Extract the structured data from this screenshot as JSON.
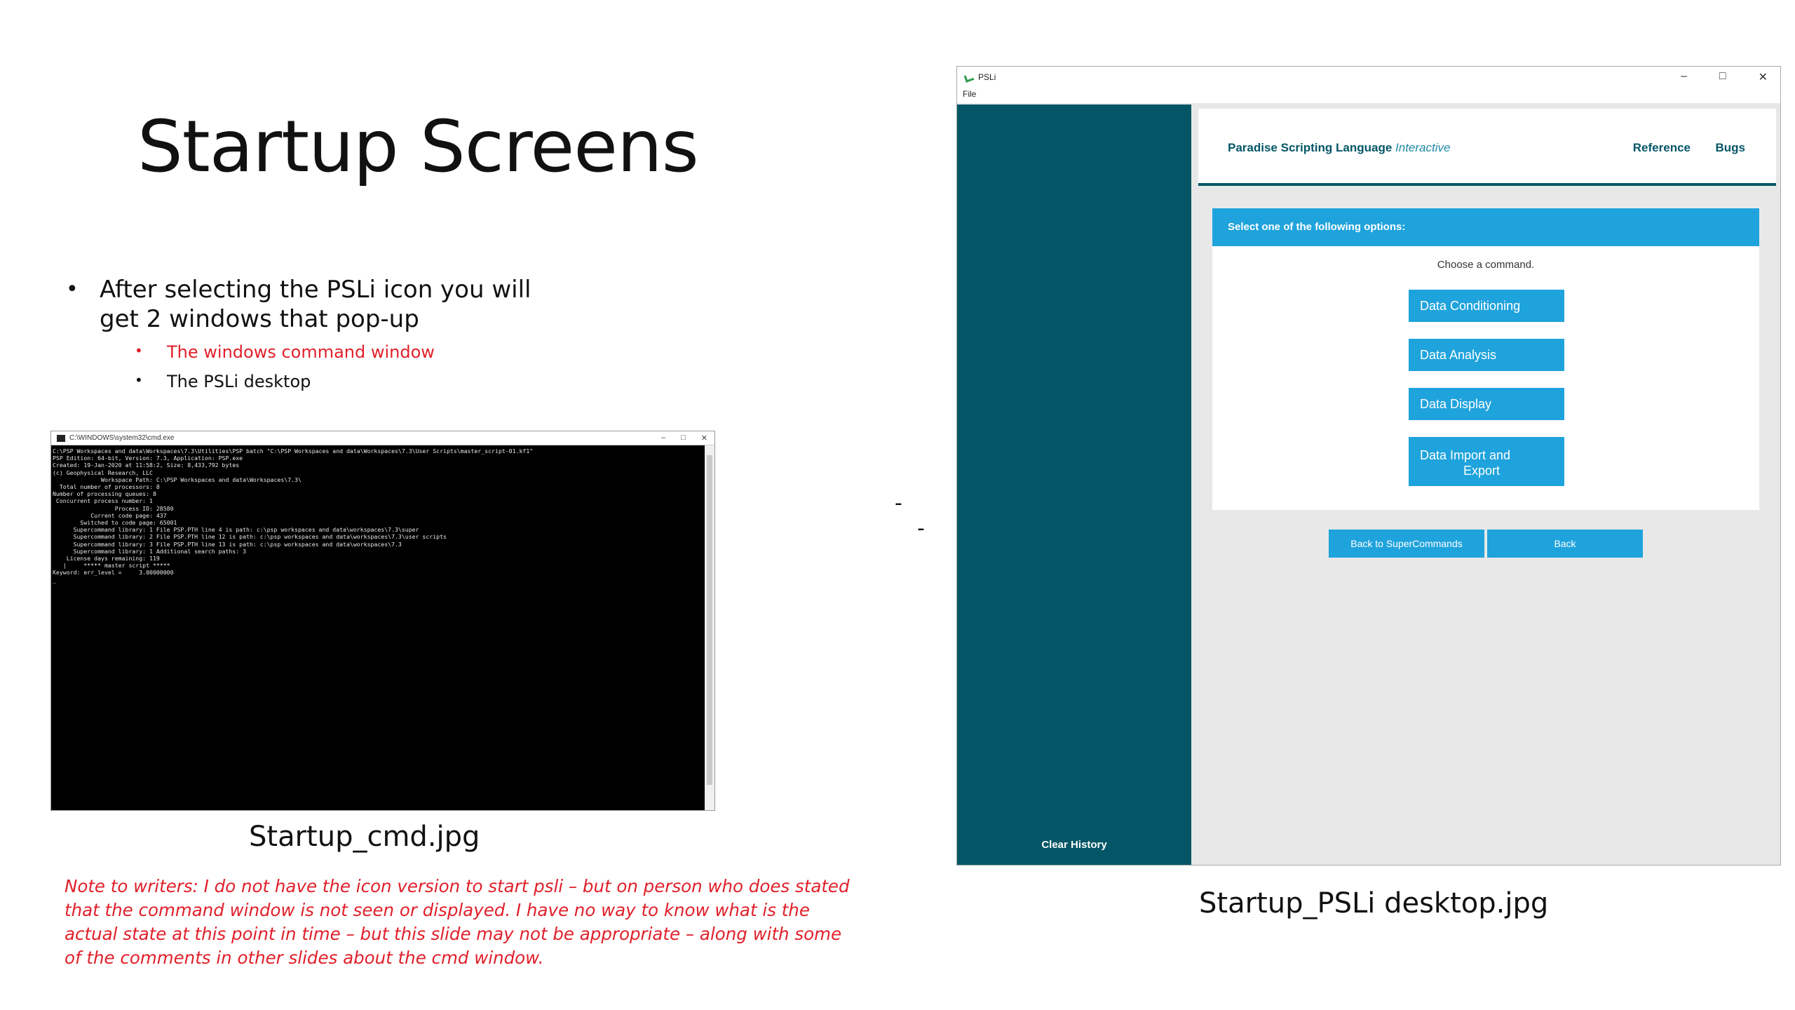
{
  "slide": {
    "title": "Startup Screens",
    "bullet_main": "After selecting  the PSLi icon you will get 2 windows that pop-up",
    "sub_bullets": [
      "The windows command window",
      "The PSLi desktop"
    ],
    "bullet_symbol": "•",
    "cmd_caption": "Startup_cmd.jpg",
    "psli_caption": "Startup_PSLi desktop.jpg",
    "note": "Note to writers:  I do not have the icon version to start psli – but on person who does stated that the command window is not seen or displayed.   I have no way to know what is the actual state at this point in time – but this slide may not be appropriate – along with some of the comments in other slides about the cmd window.",
    "dash1": "-",
    "dash2": "-",
    "colors": {
      "note": "#e0202a",
      "sub_bullet_highlight": "#e0202a"
    }
  },
  "cmd_window": {
    "title": "C:\\WINDOWS\\system32\\cmd.exe",
    "controls": [
      "–",
      "□",
      "✕"
    ],
    "lines": [
      "C:\\PSP Workspaces and data\\Workspaces\\7.3\\Utilities\\PSP batch \"C:\\PSP Workspaces and data\\Workspaces\\7.3\\User Scripts\\master_script-01.kf1\"",
      "PSP Edition: 64-bit, Version: 7.3, Application: PSP.exe",
      "Created: 19-Jan-2020 at 11:58:2, Size: 8,433,792 bytes",
      "(c) Geophysical Research, LLC",
      "              Workspace Path: C:\\PSP Workspaces and data\\Workspaces\\7.3\\",
      "  Total number of processors: 8",
      "Number of processing queues: 8",
      " Concurrent process number: 1",
      "                  Process ID: 28580",
      "           Current code page: 437",
      "        Switched to code page: 65001",
      "      Supercommand library: 1 File PSP.PTH line 4 is path: c:\\psp workspaces and data\\workspaces\\7.3\\super",
      "      Supercommand library: 2 File PSP.PTH line 12 is path: c:\\psp workspaces and data\\workspaces\\7.3\\user scripts",
      "      Supercommand library: 3 File PSP.PTH line 13 is path: c:\\psp workspaces and data\\workspaces\\7.3",
      "      Supercommand library: 1 Additional search paths: 3",
      "    License days remaining: 119",
      "   |     ***** master script *****",
      "Keyword: err_level =     3.00000000",
      "_"
    ]
  },
  "psli_window": {
    "title": "PSLi",
    "controls": [
      "–",
      "□",
      "✕"
    ],
    "menu": {
      "file": "File"
    },
    "sidebar": {
      "clear_history": "Clear History"
    },
    "header": {
      "app_name": "Paradise Scripting Language",
      "app_name_italic": "Interactive",
      "nav_reference": "Reference",
      "nav_bugs": "Bugs"
    },
    "options": {
      "heading": "Select one of the following options:",
      "prompt": "Choose a command.",
      "buttons": {
        "conditioning": "Data Conditioning",
        "analysis": "Data Analysis",
        "display": "Data Display",
        "import_line1": "Data Import and",
        "import_line2": "Export"
      }
    },
    "bottom_buttons": {
      "back_super": "Back to SuperCommands",
      "back": "Back"
    },
    "colors": {
      "sidebar": "#045666",
      "accent": "#1fa3dc"
    }
  }
}
